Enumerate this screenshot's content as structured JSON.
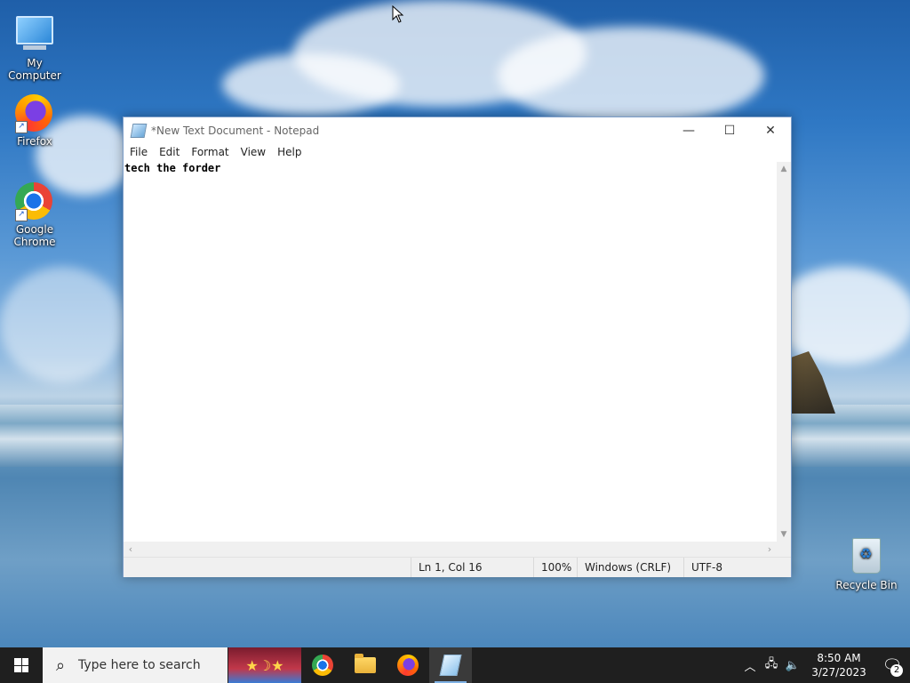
{
  "desktop": {
    "icons": [
      {
        "label": "My Computer"
      },
      {
        "label": "Firefox"
      },
      {
        "label": "Google Chrome"
      },
      {
        "label": "Recycle Bin"
      }
    ]
  },
  "notepad": {
    "title": "*New Text Document - Notepad",
    "menu": [
      "File",
      "Edit",
      "Format",
      "View",
      "Help"
    ],
    "content": "tech the forder",
    "status": {
      "position": "Ln 1, Col 16",
      "zoom": "100%",
      "line_ending": "Windows (CRLF)",
      "encoding": "UTF-8"
    },
    "controls": {
      "minimize": "—",
      "maximize": "☐",
      "close": "✕"
    }
  },
  "taskbar": {
    "search_placeholder": "Type here to search",
    "clock": {
      "time": "8:50 AM",
      "date": "3/27/2023"
    },
    "notification_count": "2",
    "tray_icons": [
      "chevron-up-icon",
      "network-icon",
      "volume-icon"
    ]
  },
  "colors": {
    "taskbar": "#1f1f1f",
    "active_indicator": "#7fb2e5",
    "window_border": "#7a9cc8"
  }
}
